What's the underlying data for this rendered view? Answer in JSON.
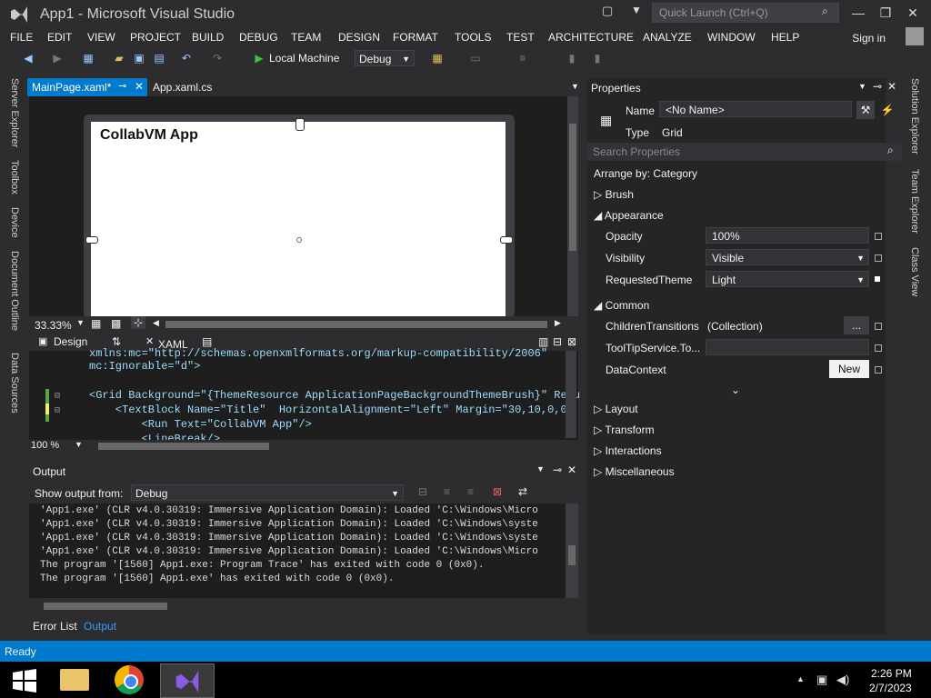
{
  "titlebar": {
    "title": "App1 - Microsoft Visual Studio",
    "quick_launch_placeholder": "Quick Launch (Ctrl+Q)"
  },
  "menu": [
    "FILE",
    "EDIT",
    "VIEW",
    "PROJECT",
    "BUILD",
    "DEBUG",
    "TEAM",
    "DESIGN",
    "FORMAT",
    "TOOLS",
    "TEST",
    "ARCHITECTURE",
    "ANALYZE",
    "WINDOW",
    "HELP"
  ],
  "signin": "Sign in",
  "toolbar": {
    "run_label": "Local Machine",
    "config": "Debug"
  },
  "left_tabs": [
    "Server Explorer",
    "Toolbox",
    "Device",
    "Document Outline",
    "Data Sources"
  ],
  "doc_tabs": {
    "active": "MainPage.xaml*",
    "second": "App.xaml.cs"
  },
  "designer": {
    "app_title": "CollabVM App",
    "zoom": "33.33%"
  },
  "split_tabs": {
    "design": "Design",
    "xaml": "XAML"
  },
  "xaml_lines": [
    "xmlns:mc=\"http://schemas.openxmlformats.org/markup-compatibility/2006\"",
    "mc:Ignorable=\"d\">",
    "",
    "<Grid Background=\"{ThemeResource ApplicationPageBackgroundThemeBrush}\" Requ",
    "    <TextBlock Name=\"Title\"  HorizontalAlignment=\"Left\" Margin=\"30,10,0,0\"",
    "        <Run Text=\"CollabVM App\"/>",
    "        <LineBreak/>"
  ],
  "xaml_zoom": "100 %",
  "output": {
    "title": "Output",
    "show_from_label": "Show output from:",
    "source": "Debug",
    "lines": [
      "'App1.exe' (CLR v4.0.30319: Immersive Application Domain): Loaded 'C:\\Windows\\Micro",
      "'App1.exe' (CLR v4.0.30319: Immersive Application Domain): Loaded 'C:\\Windows\\syste",
      "'App1.exe' (CLR v4.0.30319: Immersive Application Domain): Loaded 'C:\\Windows\\syste",
      "'App1.exe' (CLR v4.0.30319: Immersive Application Domain): Loaded 'C:\\Windows\\Micro",
      "The program '[1560] App1.exe: Program Trace' has exited with code 0 (0x0).",
      "The program '[1560] App1.exe' has exited with code 0 (0x0)."
    ]
  },
  "bottom_tabs": [
    "Error List",
    "Output"
  ],
  "properties": {
    "title": "Properties",
    "name_label": "Name",
    "name_value": "<No Name>",
    "type_label": "Type",
    "type_value": "Grid",
    "search_placeholder": "Search Properties",
    "arrange": "Arrange by: Category",
    "sections": {
      "brush": "Brush",
      "appearance": "Appearance",
      "common": "Common",
      "layout": "Layout",
      "transform": "Transform",
      "interactions": "Interactions",
      "misc": "Miscellaneous"
    },
    "appearance": [
      {
        "label": "Opacity",
        "value": "100%"
      },
      {
        "label": "Visibility",
        "value": "Visible"
      },
      {
        "label": "RequestedTheme",
        "value": "Light"
      }
    ],
    "common": [
      {
        "label": "ChildrenTransitions",
        "value": "(Collection)",
        "button": "..."
      },
      {
        "label": "ToolTipService.To...",
        "value": ""
      },
      {
        "label": "DataContext",
        "button": "New"
      }
    ]
  },
  "right_tabs": [
    "Solution Explorer",
    "Team Explorer",
    "Class View"
  ],
  "status": "Ready",
  "clock": {
    "time": "2:26 PM",
    "date": "2/7/2023"
  },
  "colors": {
    "accent": "#007acc",
    "bg": "#2d2d30",
    "editor": "#1e1e1e"
  }
}
